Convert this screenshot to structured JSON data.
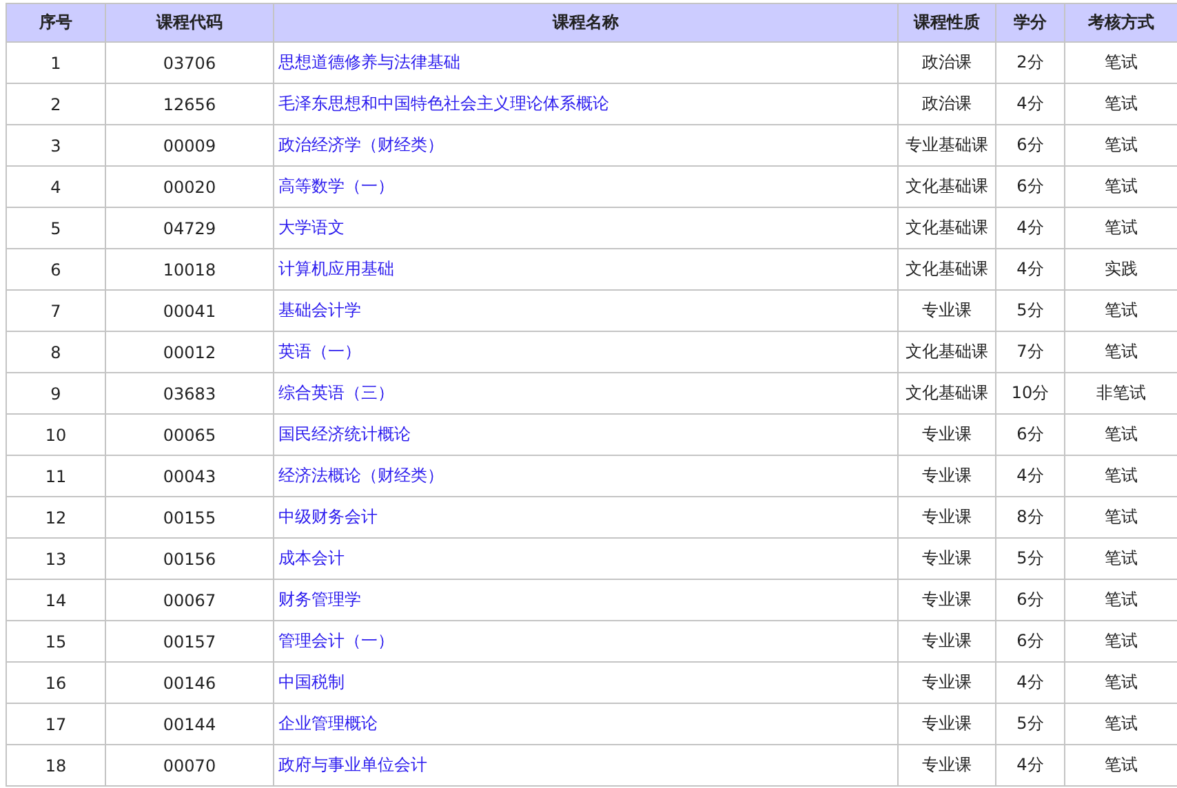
{
  "table": {
    "columns": [
      "序号",
      "课程代码",
      "课程名称",
      "课程性质",
      "学分",
      "考核方式"
    ],
    "rows": [
      {
        "no": "1",
        "code": "03706",
        "name": "思想道德修养与法律基础",
        "type": "政治课",
        "credit": "2分",
        "exam": "笔试"
      },
      {
        "no": "2",
        "code": "12656",
        "name": "毛泽东思想和中国特色社会主义理论体系概论",
        "type": "政治课",
        "credit": "4分",
        "exam": "笔试"
      },
      {
        "no": "3",
        "code": "00009",
        "name": "政治经济学（财经类）",
        "type": "专业基础课",
        "credit": "6分",
        "exam": "笔试"
      },
      {
        "no": "4",
        "code": "00020",
        "name": "高等数学（一）",
        "type": "文化基础课",
        "credit": "6分",
        "exam": "笔试"
      },
      {
        "no": "5",
        "code": "04729",
        "name": "大学语文",
        "type": "文化基础课",
        "credit": "4分",
        "exam": "笔试"
      },
      {
        "no": "6",
        "code": "10018",
        "name": "计算机应用基础",
        "type": "文化基础课",
        "credit": "4分",
        "exam": "实践"
      },
      {
        "no": "7",
        "code": "00041",
        "name": "基础会计学",
        "type": "专业课",
        "credit": "5分",
        "exam": "笔试"
      },
      {
        "no": "8",
        "code": "00012",
        "name": "英语（一）",
        "type": "文化基础课",
        "credit": "7分",
        "exam": "笔试"
      },
      {
        "no": "9",
        "code": "03683",
        "name": "综合英语（三）",
        "type": "文化基础课",
        "credit": "10分",
        "exam": "非笔试"
      },
      {
        "no": "10",
        "code": "00065",
        "name": "国民经济统计概论",
        "type": "专业课",
        "credit": "6分",
        "exam": "笔试"
      },
      {
        "no": "11",
        "code": "00043",
        "name": "经济法概论（财经类）",
        "type": "专业课",
        "credit": "4分",
        "exam": "笔试"
      },
      {
        "no": "12",
        "code": "00155",
        "name": "中级财务会计",
        "type": "专业课",
        "credit": "8分",
        "exam": "笔试"
      },
      {
        "no": "13",
        "code": "00156",
        "name": "成本会计",
        "type": "专业课",
        "credit": "5分",
        "exam": "笔试"
      },
      {
        "no": "14",
        "code": "00067",
        "name": "财务管理学",
        "type": "专业课",
        "credit": "6分",
        "exam": "笔试"
      },
      {
        "no": "15",
        "code": "00157",
        "name": "管理会计（一）",
        "type": "专业课",
        "credit": "6分",
        "exam": "笔试"
      },
      {
        "no": "16",
        "code": "00146",
        "name": "中国税制",
        "type": "专业课",
        "credit": "4分",
        "exam": "笔试"
      },
      {
        "no": "17",
        "code": "00144",
        "name": "企业管理概论",
        "type": "专业课",
        "credit": "5分",
        "exam": "笔试"
      },
      {
        "no": "18",
        "code": "00070",
        "name": "政府与事业单位会计",
        "type": "专业课",
        "credit": "4分",
        "exam": "笔试"
      }
    ]
  }
}
